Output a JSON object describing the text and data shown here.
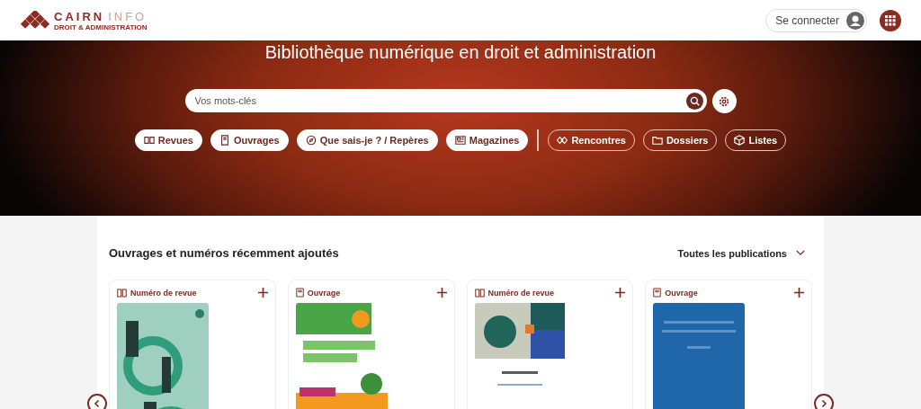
{
  "header": {
    "logo_name": "CAIRN",
    "logo_suffix": "INFO",
    "logo_subtitle": "DROIT & ADMINISTRATION",
    "login_button": "Se connecter"
  },
  "hero": {
    "title": "Bibliothèque numérique en droit et administration",
    "search": {
      "placeholder": "Vos mots-clés"
    },
    "chips": [
      {
        "label": "Revues",
        "kind": "filled"
      },
      {
        "label": "Ouvrages",
        "kind": "filled"
      },
      {
        "label": "Que sais-je ? / Repères",
        "kind": "filled"
      },
      {
        "label": "Magazines",
        "kind": "filled"
      },
      {
        "label": "Rencontres",
        "kind": "outline"
      },
      {
        "label": "Dossiers",
        "kind": "outline"
      },
      {
        "label": "Listes",
        "kind": "outline"
      }
    ]
  },
  "section": {
    "title": "Ouvrages et numéros récemment ajoutés",
    "filter": "Toutes les publications",
    "cards": [
      {
        "type_label": "Numéro de revue",
        "kind": "revue"
      },
      {
        "type_label": "Ouvrage",
        "kind": "ouvrage"
      },
      {
        "type_label": "Numéro de revue",
        "kind": "revue"
      },
      {
        "type_label": "Ouvrage",
        "kind": "ouvrage"
      }
    ]
  }
}
